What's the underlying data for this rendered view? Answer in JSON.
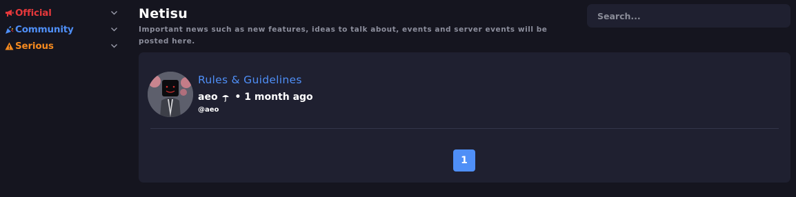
{
  "sidebar": {
    "categories": [
      {
        "label": "Official",
        "icon": "megaphone-icon",
        "color": "#e5383b"
      },
      {
        "label": "Community",
        "icon": "party-popper-icon",
        "color": "#4f8ff7"
      },
      {
        "label": "Serious",
        "icon": "warning-icon",
        "color": "#f58a1f"
      }
    ]
  },
  "header": {
    "title": "Netisu",
    "description": "Important news such as new features, ideas to talk about, events and server events will be posted here."
  },
  "search": {
    "placeholder": "Search..."
  },
  "threads": [
    {
      "title": "Rules & Guidelines",
      "author": "aeo",
      "author_icon": "umbrella-icon",
      "time": "1 month ago",
      "handle": "@aeo"
    }
  ],
  "pagination": {
    "current": "1"
  },
  "colors": {
    "background": "#15151f",
    "panel": "#1f2030",
    "accent": "#4f8ff7",
    "official": "#e5383b",
    "serious": "#f58a1f"
  }
}
